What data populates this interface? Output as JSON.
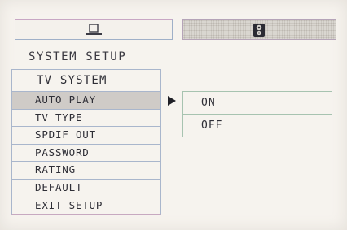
{
  "tabs": {
    "setup_icon": "monitor-icon",
    "speaker_icon": "speaker-icon"
  },
  "title": "SYSTEM SETUP",
  "menu": {
    "header": "TV SYSTEM",
    "items": [
      {
        "label": "AUTO PLAY",
        "selected": true
      },
      {
        "label": "TV TYPE",
        "selected": false
      },
      {
        "label": "SPDIF OUT",
        "selected": false
      },
      {
        "label": "PASSWORD",
        "selected": false
      },
      {
        "label": "RATING",
        "selected": false
      },
      {
        "label": "DEFAULT",
        "selected": false
      },
      {
        "label": "EXIT SETUP",
        "selected": false
      }
    ]
  },
  "submenu": {
    "options": [
      "ON",
      "OFF"
    ]
  },
  "colors": {
    "background": "#f6f3ee",
    "selected": "#cfcbc7",
    "text": "#2e2e36"
  }
}
